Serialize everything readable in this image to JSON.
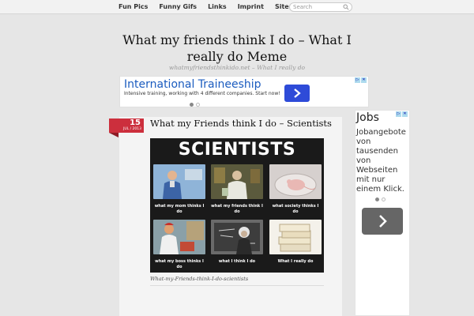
{
  "nav": {
    "items": [
      "Fun Pics",
      "Funny Gifs",
      "Links",
      "Imprint",
      "Sitemap"
    ],
    "search_placeholder": "Search"
  },
  "header": {
    "title": "What my friends think I do – What I really do Meme",
    "tagline": "whatmyfriendsthinkido.net – What I really do"
  },
  "ad_top": {
    "headline": "International Traineeship",
    "description": "Intensive training, working with 4 different companies. Start now!"
  },
  "post": {
    "day": "15",
    "month": "JUL / 2013",
    "title": "What my Friends think I do – Scientists",
    "meme_title": "SCIENTISTS",
    "panels": [
      "what my mom thinks I do",
      "what my friends think I do",
      "what society thinks I do",
      "what my boss thinks I do",
      "what I think I do",
      "What I really do"
    ],
    "caption": "What-my-Friends-think-I-do-scientists"
  },
  "ad_side": {
    "headline": "Jobs",
    "body": "Jobangebote von tausenden von Webseiten mit nur einem Klick."
  },
  "colors": {
    "accent": "#cc2f3d",
    "link_blue": "#1a5bbf",
    "ad_button": "#2e4bd8"
  }
}
